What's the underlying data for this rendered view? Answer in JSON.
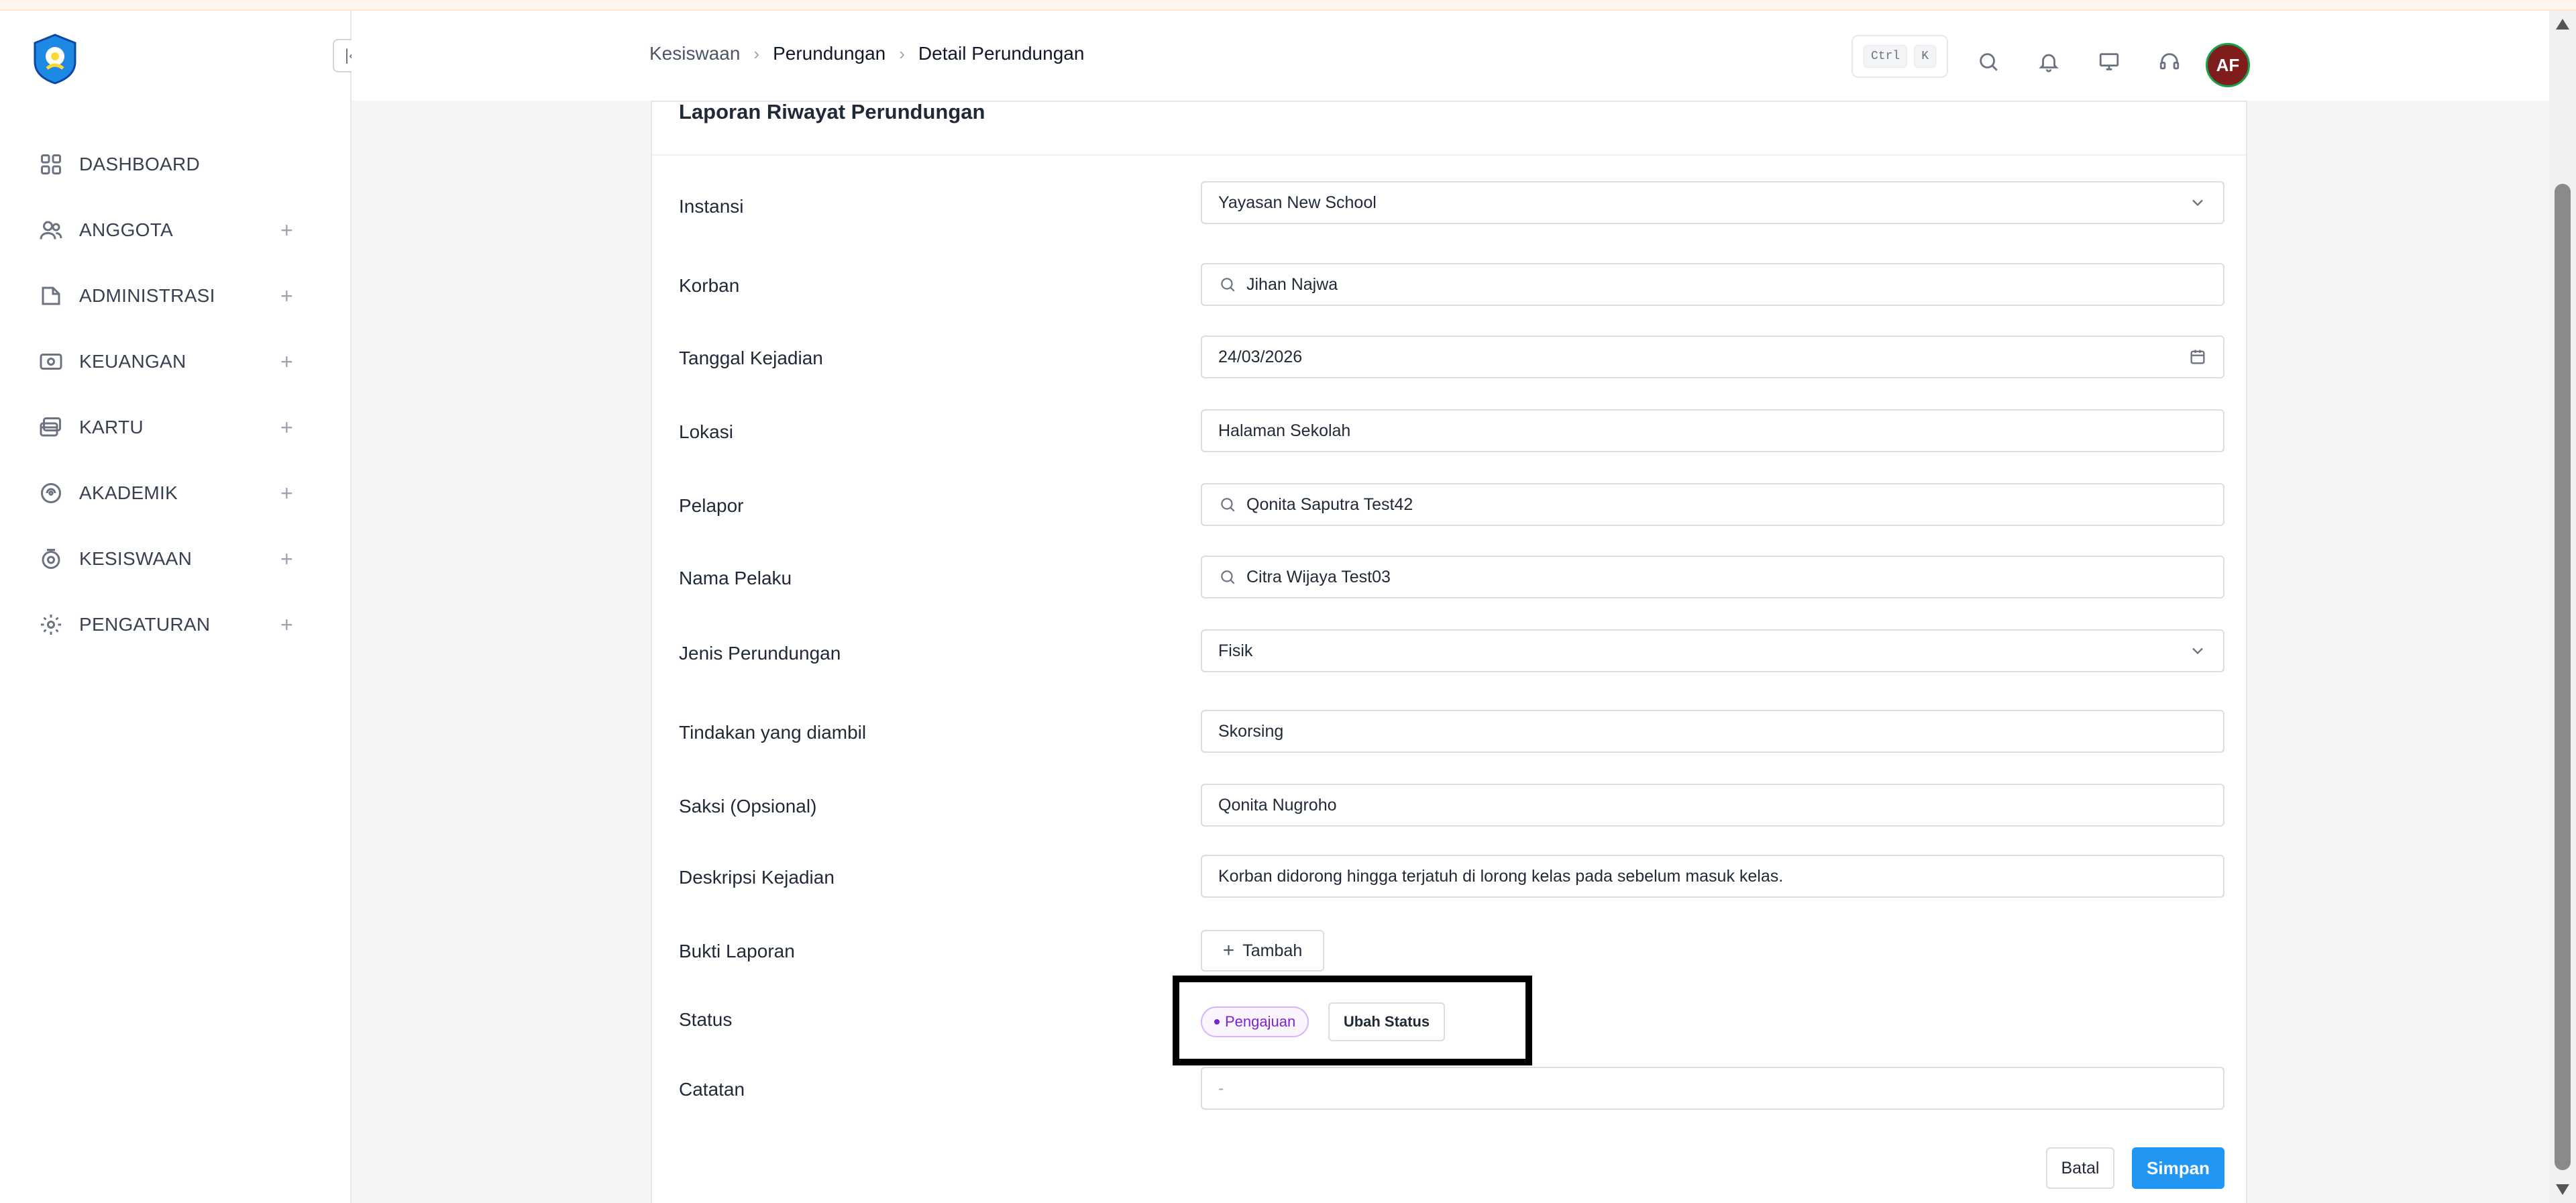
{
  "sidebar": {
    "items": [
      {
        "label": "DASHBOARD",
        "icon": "dashboard-icon",
        "expandable": false
      },
      {
        "label": "ANGGOTA",
        "icon": "users-icon",
        "expandable": true
      },
      {
        "label": "ADMINISTRASI",
        "icon": "folder-icon",
        "expandable": true
      },
      {
        "label": "KEUANGAN",
        "icon": "money-icon",
        "expandable": true
      },
      {
        "label": "KARTU",
        "icon": "card-icon",
        "expandable": true
      },
      {
        "label": "AKADEMIK",
        "icon": "academic-icon",
        "expandable": true
      },
      {
        "label": "KESISWAAN",
        "icon": "student-icon",
        "expandable": true
      },
      {
        "label": "PENGATURAN",
        "icon": "gear-icon",
        "expandable": true
      }
    ]
  },
  "header": {
    "breadcrumb": [
      "Kesiswaan",
      "Perundungan",
      "Detail Perundungan"
    ],
    "shortcut_keys": [
      "Ctrl",
      "K"
    ],
    "avatar_initials": "AF"
  },
  "form": {
    "title": "Laporan Riwayat Perundungan",
    "fields": {
      "instansi": {
        "label": "Instansi",
        "value": "Yayasan New School"
      },
      "korban": {
        "label": "Korban",
        "value": "Jihan Najwa"
      },
      "tanggal": {
        "label": "Tanggal Kejadian",
        "value": "24/03/2026"
      },
      "lokasi": {
        "label": "Lokasi",
        "value": "Halaman Sekolah"
      },
      "pelapor": {
        "label": "Pelapor",
        "value": "Qonita Saputra Test42"
      },
      "pelaku": {
        "label": "Nama Pelaku",
        "value": "Citra Wijaya Test03"
      },
      "jenis": {
        "label": "Jenis Perundungan",
        "value": "Fisik"
      },
      "tindakan": {
        "label": "Tindakan yang diambil",
        "value": "Skorsing"
      },
      "saksi": {
        "label": "Saksi (Opsional)",
        "value": "Qonita Nugroho"
      },
      "deskripsi": {
        "label": "Deskripsi Kejadian",
        "value": "Korban didorong hingga terjatuh di lorong kelas pada sebelum masuk kelas."
      },
      "bukti": {
        "label": "Bukti Laporan",
        "button": "Tambah"
      },
      "status": {
        "label": "Status",
        "badge": "Pengajuan",
        "button": "Ubah Status"
      },
      "catatan": {
        "label": "Catatan",
        "value": "-"
      }
    },
    "actions": {
      "cancel": "Batal",
      "save": "Simpan"
    }
  },
  "colors": {
    "primary": "#2196f3",
    "status_badge": "#7e22ce",
    "highlight_box": "#000000"
  }
}
